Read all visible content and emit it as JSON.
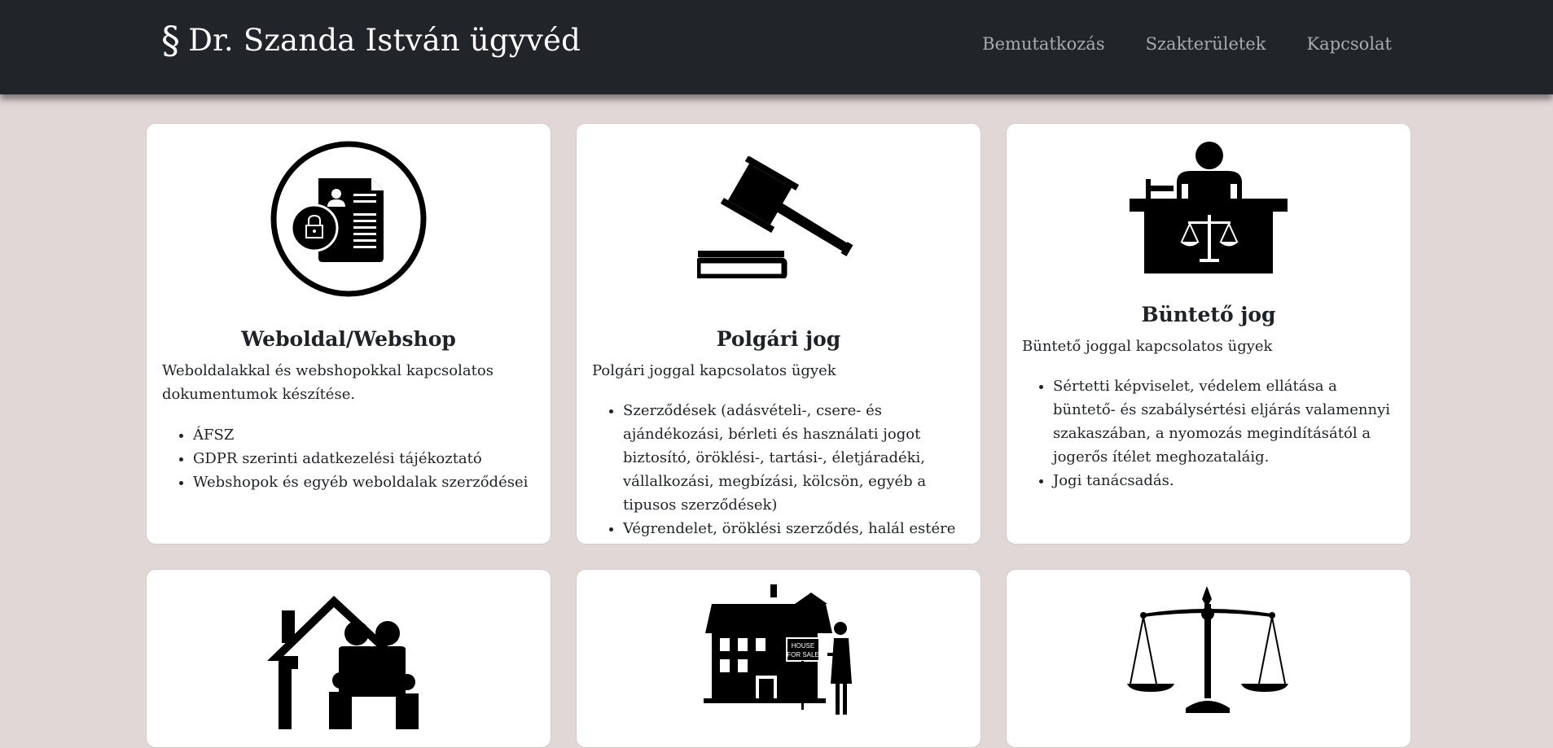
{
  "navbar": {
    "brand_mark": "§",
    "brand_name": "Dr. Szanda István ügyvéd",
    "links": [
      "Bemutatkozás",
      "Szakterületek",
      "Kapcsolat"
    ]
  },
  "cards": [
    {
      "icon": "document-lock-icon",
      "title": "Weboldal/Webshop",
      "lead": "Weboldalakkal és webshopokkal kapcsolatos dokumentumok készítése.",
      "items": [
        "ÁFSZ",
        "GDPR szerinti adatkezelési tájékoztató",
        "Webshopok és egyéb weboldalak szerződései"
      ]
    },
    {
      "icon": "gavel-icon",
      "title": "Polgári jog",
      "lead": "Polgári joggal kapcsolatos ügyek",
      "items": [
        "Szerződések (adásvételi-, csere- és ajándékozási, bérleti és használati jogot biztosító, öröklési-, tartási-, életjáradéki, vállalkozási, megbízási, kölcsön, egyéb a tipusos szerződések)",
        "Végrendelet, öröklési szerződés, halál estére szóló ajándékozás elkészítése"
      ]
    },
    {
      "icon": "judge-desk-icon",
      "title": "Büntető jog",
      "lead": "Büntető joggal kapcsolatos ügyek",
      "items": [
        "Sértetti képviselet, védelem ellátása a büntető- és szabálysértési eljárás valamennyi szakaszában, a nyomozás megindításától a jogerős ítélet meghozataláig.",
        "Jogi tanácsadás."
      ]
    },
    {
      "icon": "family-house-icon"
    },
    {
      "icon": "house-for-sale-icon",
      "sign_text": [
        "HOUSE",
        "FOR SALE"
      ]
    },
    {
      "icon": "scales-of-justice-icon"
    }
  ],
  "colors": {
    "navbar_bg": "#212428",
    "page_bg": "#e2d7d7",
    "card_bg": "#ffffff",
    "text": "#1f2226",
    "nav_link": "#a9abad"
  }
}
